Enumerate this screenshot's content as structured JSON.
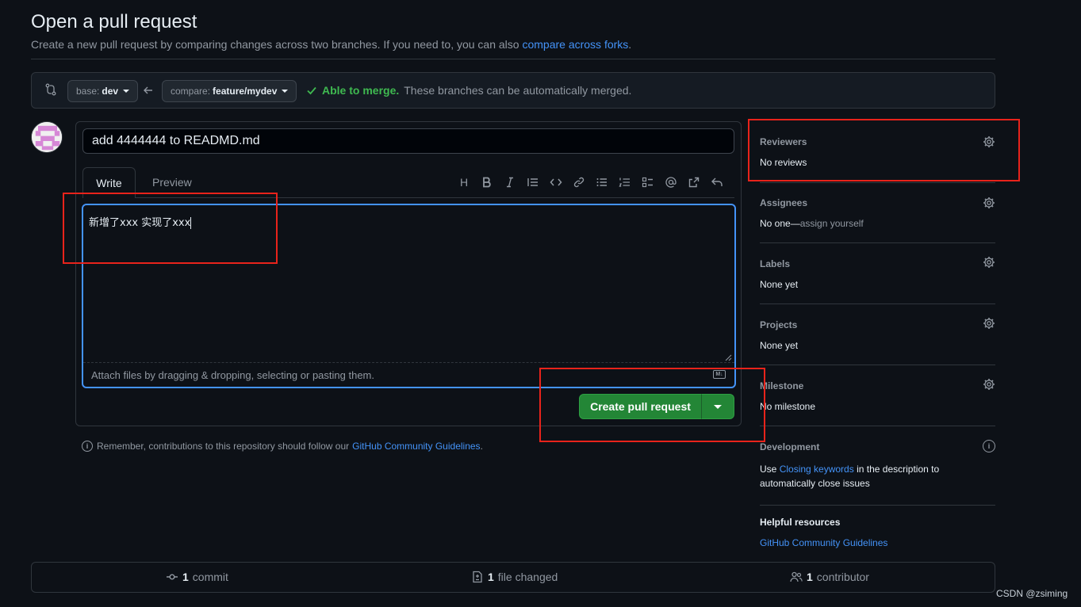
{
  "header": {
    "title": "Open a pull request",
    "subtitle": "Create a new pull request by comparing changes across two branches. If you need to, you can also",
    "subtitle_link": "compare across forks",
    "subtitle_end": "."
  },
  "compare": {
    "base_prefix": "base:",
    "base_branch": "dev",
    "compare_prefix": "compare:",
    "compare_branch": "feature/mydev",
    "merge_ok": "Able to merge.",
    "merge_text": "These branches can be automatically merged."
  },
  "form": {
    "title_value": "add 4444444 to READMD.md",
    "tab_write": "Write",
    "tab_preview": "Preview",
    "body_value": "新增了xxx 实现了xxx",
    "attach_hint": "Attach files by dragging & dropping, selecting or pasting them.",
    "md_badge": "M↓",
    "create_label": "Create pull request",
    "toolbar_heading": "H"
  },
  "remember": {
    "text": "Remember, contributions to this repository should follow our",
    "link": "GitHub Community Guidelines",
    "end": "."
  },
  "sidebar": {
    "reviewers_title": "Reviewers",
    "reviewers_value": "No reviews",
    "assignees_title": "Assignees",
    "assignees_value": "No one—",
    "assignees_link": "assign yourself",
    "labels_title": "Labels",
    "labels_value": "None yet",
    "projects_title": "Projects",
    "projects_value": "None yet",
    "milestone_title": "Milestone",
    "milestone_value": "No milestone",
    "development_title": "Development",
    "development_pre": "Use",
    "development_link": "Closing keywords",
    "development_post": "in the description to",
    "development_line2": "automatically close issues",
    "helpful_title": "Helpful resources",
    "helpful_link": "GitHub Community Guidelines"
  },
  "stats": {
    "commits_count": "1",
    "commits_label": "commit",
    "files_count": "1",
    "files_label": "file changed",
    "contributors_count": "1",
    "contributors_label": "contributor"
  },
  "watermark": "CSDN @zsiming",
  "colors": {
    "background": "#0d1117",
    "accent_blue": "#4493f8",
    "success_green": "#238636",
    "annotation_red": "#e8231b"
  }
}
